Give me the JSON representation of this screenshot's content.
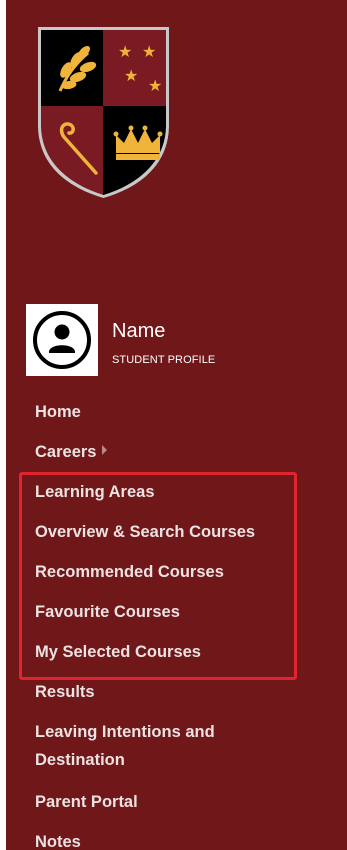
{
  "profile": {
    "name": "Name",
    "subtitle": "STUDENT PROFILE",
    "avatar_icon": "user-icon"
  },
  "crest": {
    "icon": "school-crest-logo",
    "quadrants": [
      "laurel-branch",
      "three-stars",
      "staff",
      "crown"
    ]
  },
  "nav": {
    "items": [
      {
        "label": "Home"
      },
      {
        "label": "Careers",
        "has_submenu": true
      },
      {
        "label": "Learning Areas"
      },
      {
        "label": "Overview & Search Courses"
      },
      {
        "label": "Recommended Courses"
      },
      {
        "label": "Favourite Courses"
      },
      {
        "label": "My Selected Courses"
      },
      {
        "label": "Results"
      },
      {
        "label": "Leaving Intentions and",
        "label_line2": "Destination"
      },
      {
        "label": "Parent Portal"
      },
      {
        "label": "Notes"
      }
    ]
  },
  "colors": {
    "sidebar_bg": "#6f1719",
    "nav_text": "#ece2e2",
    "highlight_border": "#e3232f",
    "crest_gold": "#f0b43a",
    "crest_maroon": "#7a1a22",
    "crest_black": "#000000"
  }
}
